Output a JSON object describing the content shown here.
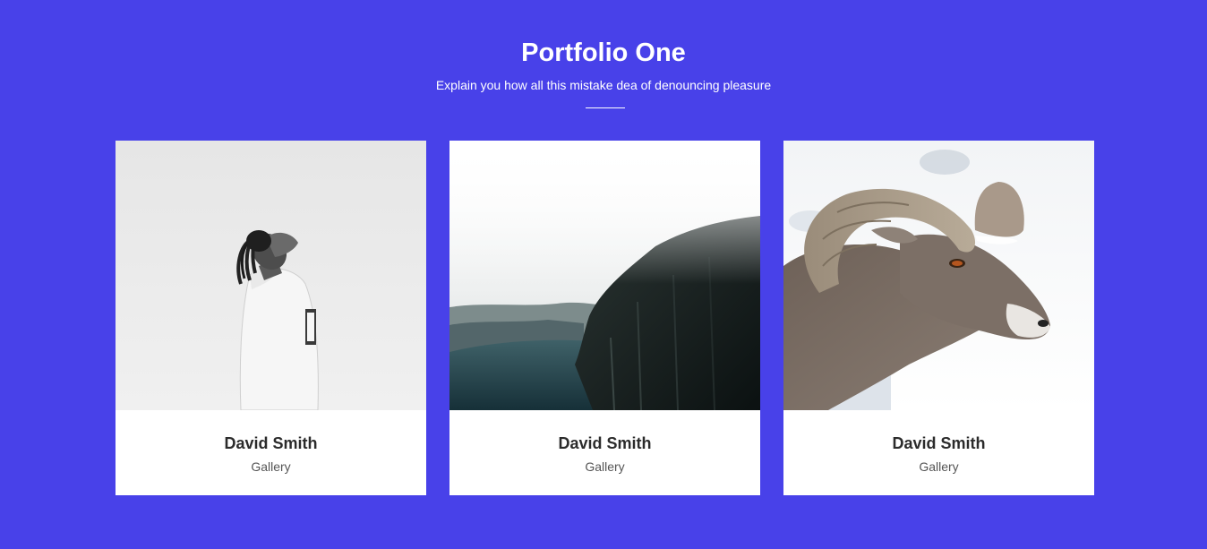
{
  "section": {
    "title": "Portfolio One",
    "subtitle": "Explain you how all this mistake dea of denouncing pleasure"
  },
  "colors": {
    "background": "#4841e9",
    "card": "#ffffff",
    "text_dark": "#2b2b2b"
  },
  "cards": [
    {
      "name": "David Smith",
      "category": "Gallery",
      "image": "man-looking-up-photo"
    },
    {
      "name": "David Smith",
      "category": "Gallery",
      "image": "misty-cliff-lake-photo"
    },
    {
      "name": "David Smith",
      "category": "Gallery",
      "image": "bighorn-ram-photo"
    }
  ]
}
